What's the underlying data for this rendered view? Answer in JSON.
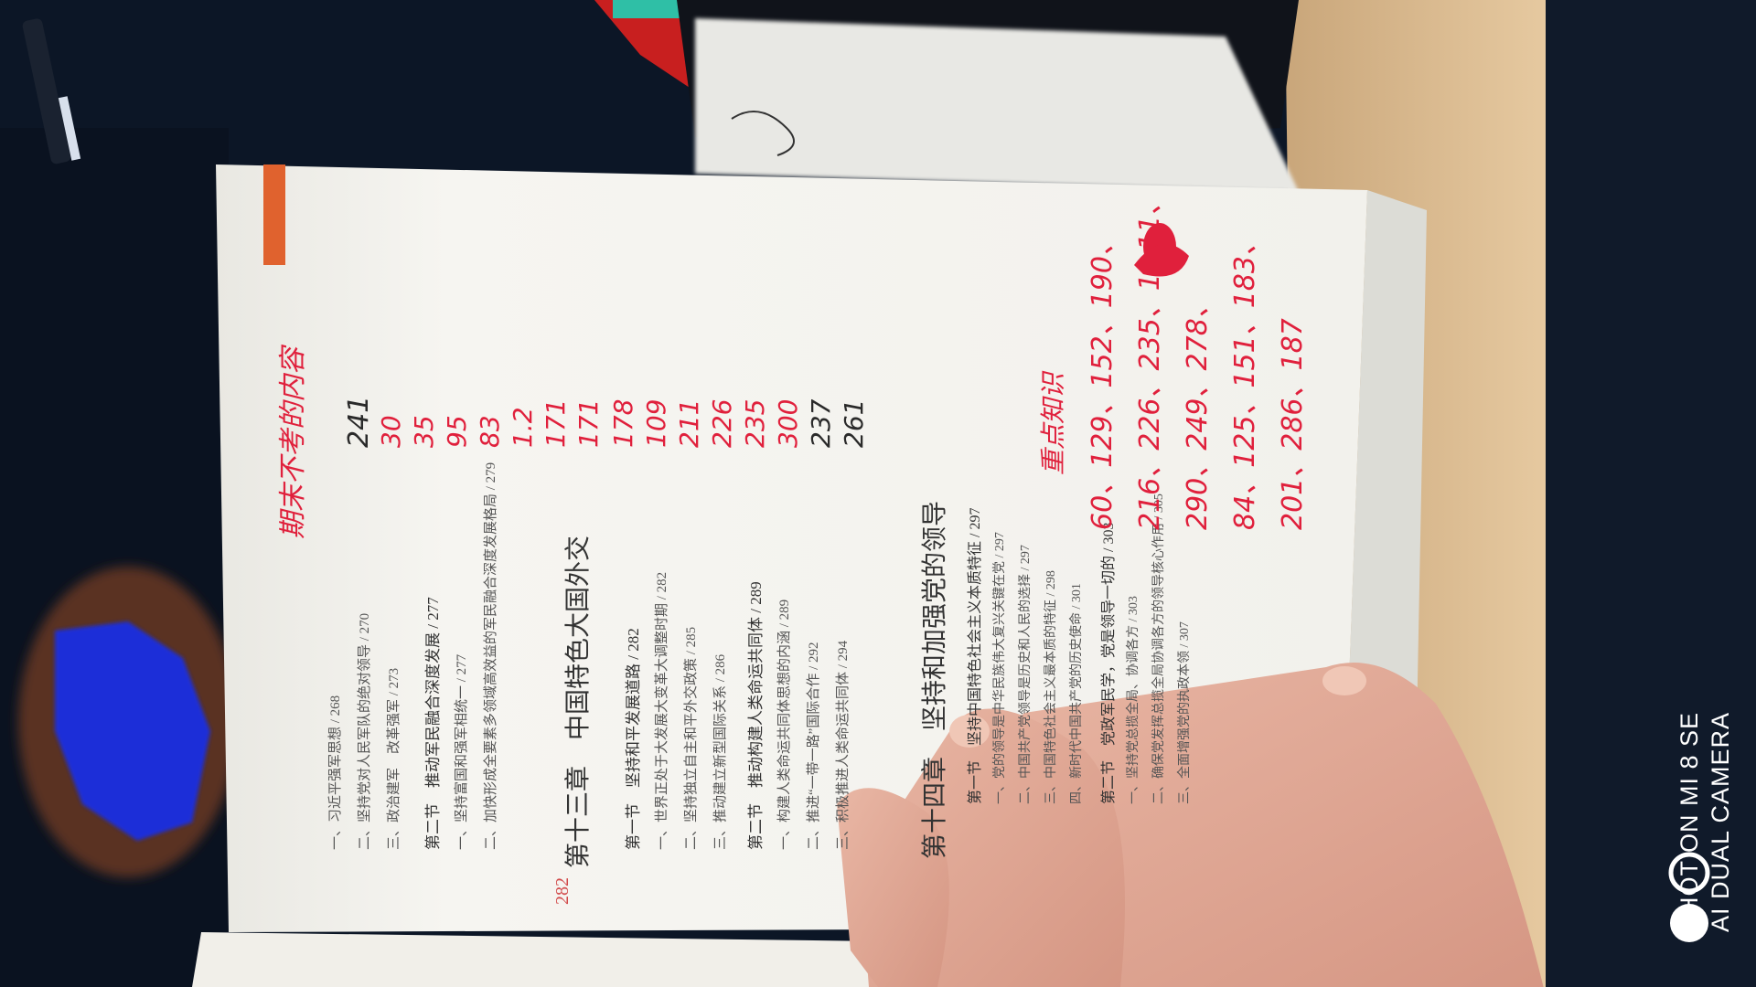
{
  "photo": {
    "subject": "book-page-rotated",
    "colors": {
      "background": "#0c1626",
      "page": "#f4f3ef",
      "desk": "#d9b98e",
      "ink_red": "#e0203c",
      "ink_dark": "#2a2a2a",
      "accent_orange": "#e0622e",
      "blue_blob": "#1e2fd8"
    }
  },
  "book": {
    "page_number": "282",
    "chapter_13_heading": "第十三章　中国特色大国外交",
    "chapter_14_heading": "第十四章　坚持和加强党的领导",
    "printed_lines_top": [
      "一、习近平强军思想 / 268",
      "二、坚持党对人民军队的绝对领导 / 270",
      "三、政治建军　改革强军 / 273",
      "第二节　推动军民融合深度发展 / 277",
      "一、坚持富国和强军相统一 / 277",
      "二、加快形成全要素多领域高效益的军民融合深度发展格局 / 279"
    ],
    "printed_lines_ch13": [
      "第一节　坚持和平发展道路 / 282",
      "一、世界正处于大发展大变革大调整时期 / 282",
      "二、坚持独立自主和平外交政策 / 285",
      "三、推动建立新型国际关系 / 286",
      "第二节　推动构建人类命运共同体 / 289",
      "一、构建人类命运共同体思想的内涵 / 289",
      "二、推进“一带一路”国际合作 / 292",
      "三、积极推进人类命运共同体 / 294"
    ],
    "printed_lines_ch14": [
      "第一节　坚持中国特色社会主义本质特征 / 297",
      "一、党的领导是中华民族伟大复兴关键在党 / 297",
      "二、中国共产党领导是历史和人民的选择 / 297",
      "三、中国特色社会主义最本质的特征 / 298",
      "四、新时代中国共产党的历史使命 / 301",
      "第二节　党政军民学，党是领导一切的 / 303",
      "一、坚持党总揽全局、协调各方 / 303",
      "二、确保党发挥总揽全局协调各方的领导核心作用 / 305",
      "三、全面增强党的执政本领 / 307"
    ]
  },
  "handwriting": {
    "top_note": "期末不考的内容",
    "numbers_column": [
      "241",
      "30",
      "35",
      "95",
      "83",
      "1.2",
      "171",
      "171",
      "178",
      "109",
      "211",
      "226",
      "235",
      "300",
      "237",
      "261"
    ],
    "side_note": "重点知识",
    "range_lines": [
      "60、129、152、190、",
      "216、226、235、1~11、",
      "290、249、278、",
      "84、125、151、183、",
      "201、286、187"
    ]
  },
  "watermark": {
    "line1": "SHOT ON MI 8 SE",
    "line2": "AI DUAL CAMERA"
  }
}
